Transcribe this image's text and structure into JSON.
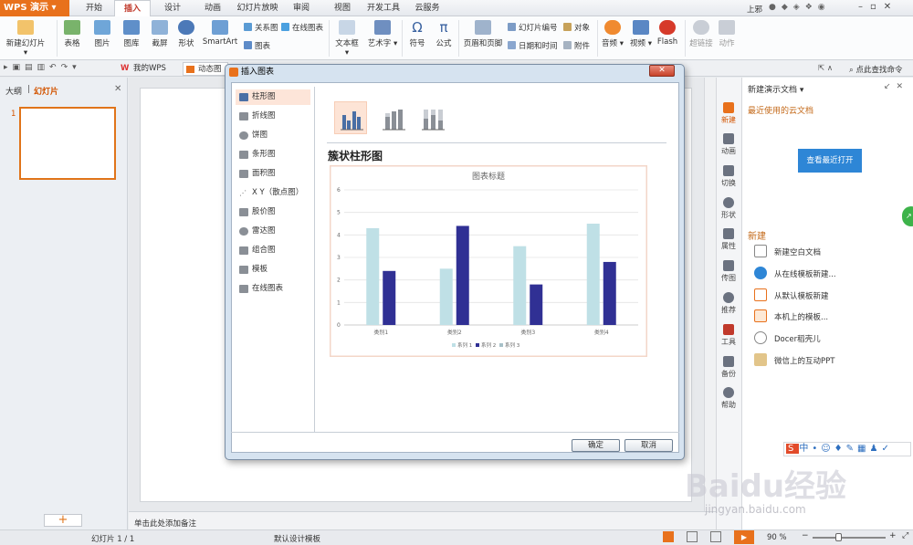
{
  "app": {
    "name": "WPS 演示"
  },
  "tabs": [
    "开始",
    "插入",
    "设计",
    "动画",
    "幻灯片放映",
    "审阅",
    "视图",
    "开发工具",
    "云服务"
  ],
  "active_tab": "插入",
  "user": "上邪",
  "ribbon": {
    "big": [
      "新建幻灯片",
      "表格",
      "图片",
      "图库",
      "截屏",
      "形状",
      "SmartArt",
      "文本框",
      "艺术字",
      "符号",
      "公式",
      "页眉和页脚",
      "音频",
      "视频",
      "Flash",
      "超链接",
      "动作"
    ],
    "small": {
      "relation": "关系图",
      "online_chart": "在线图表",
      "chart": "图表",
      "slide_number": "幻灯片编号",
      "object": "对象",
      "datetime": "日期和时间",
      "attachment": "附件"
    }
  },
  "doctabs": [
    "我的WPS",
    "动态图"
  ],
  "search_label": "点此查找命令",
  "left_panel": {
    "tab_outline": "大纲",
    "tab_slides": "幻灯片",
    "slide_number": "1"
  },
  "notes_placeholder": "单击此处添加备注",
  "sidebar": [
    "新建",
    "动画",
    "切换",
    "形状",
    "属性",
    "传图",
    "推荐",
    "工具",
    "备份",
    "帮助"
  ],
  "taskpane": {
    "header": "新建演示文档",
    "recent_title": "最近使用的云文档",
    "open_recent": "查看最近打开",
    "new_title": "新建",
    "items": [
      "新建空白文档",
      "从在线模板新建...",
      "从默认模板新建",
      "本机上的模板...",
      "Docer稻壳儿",
      "微信上的互动PPT"
    ]
  },
  "status": {
    "slide_info": "幻灯片 1 / 1",
    "template": "默认设计模板",
    "zoom": "90 %"
  },
  "dialog": {
    "title": "插入图表",
    "types": [
      "柱形图",
      "折线图",
      "饼图",
      "条形图",
      "面积图",
      "X Y（散点图）",
      "股价图",
      "雷达图",
      "组合图",
      "模板",
      "在线图表"
    ],
    "selected_type": "柱形图",
    "subtype_title": "簇状柱形图",
    "ok": "确定",
    "cancel": "取消"
  },
  "chart_data": {
    "type": "bar",
    "title": "图表标题",
    "categories": [
      "类别1",
      "类别2",
      "类别3",
      "类别4"
    ],
    "series": [
      {
        "name": "系列 1",
        "values": [
          4.3,
          2.5,
          3.5,
          4.5
        ],
        "color": "#bfe0e6"
      },
      {
        "name": "系列 2",
        "values": [
          2.4,
          4.4,
          1.8,
          2.8
        ],
        "color": "#303094"
      },
      {
        "name": "系列 3",
        "values": [],
        "color": "#a7c0c8"
      }
    ],
    "ylim": [
      0,
      6
    ],
    "yticks": [
      "0",
      "1",
      "2",
      "3",
      "4",
      "5",
      "6"
    ],
    "grid": true,
    "legend": "bottom"
  },
  "watermark": {
    "main": "Baidu经验",
    "sub": "jingyan.baidu.com"
  }
}
